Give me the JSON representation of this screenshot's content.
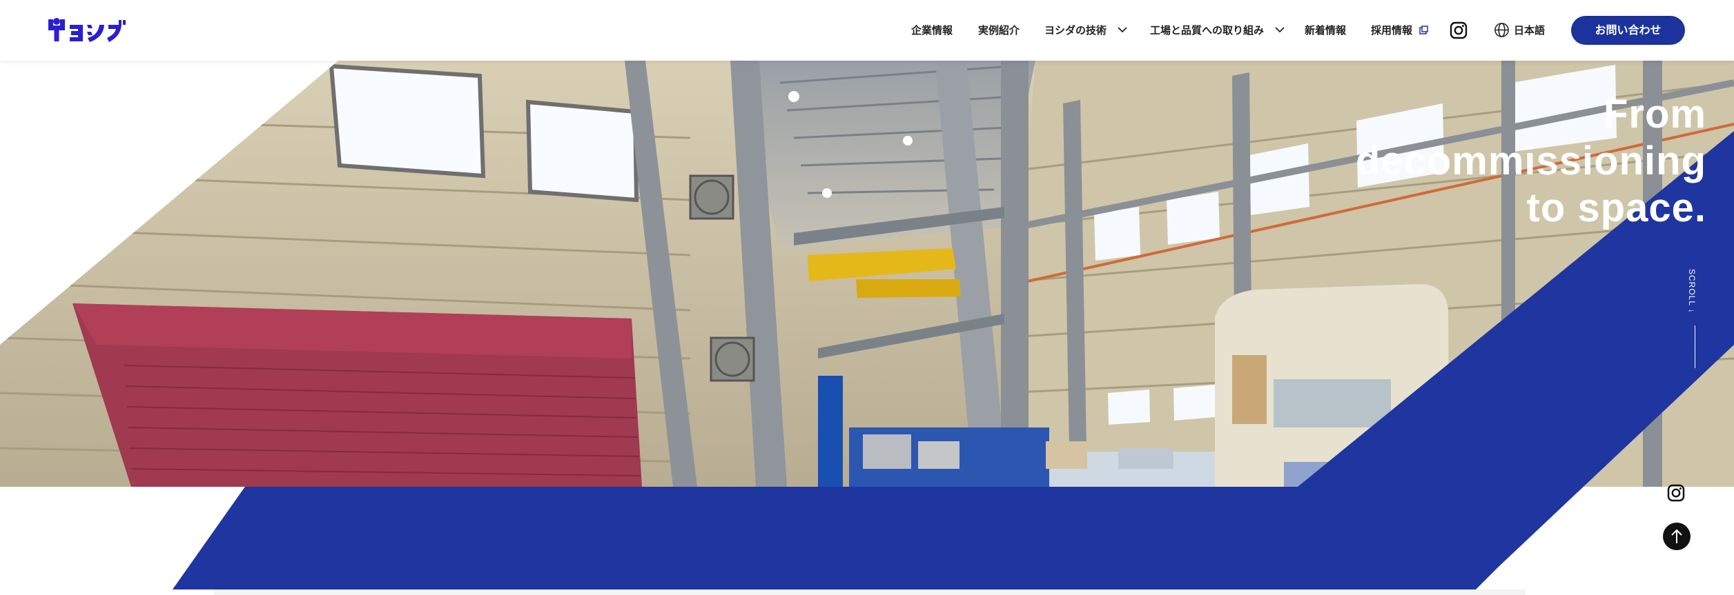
{
  "brand": {
    "logo_text": "ヨシダ",
    "colors": {
      "primary": "#1c329c",
      "logo": "#2a1fd1"
    }
  },
  "nav": {
    "items": [
      {
        "label": "企業情報",
        "icon": null
      },
      {
        "label": "実例紹介",
        "icon": null
      },
      {
        "label": "ヨシダの技術",
        "icon": "chevron-down-icon"
      },
      {
        "label": "工場と品質への取り組み",
        "icon": "chevron-down-icon"
      },
      {
        "label": "新着情報",
        "icon": null
      },
      {
        "label": "採用情報",
        "icon": "external-link-icon"
      }
    ],
    "instagram_icon": "instagram-icon",
    "language_label": "日本語",
    "language_icon": "globe-icon",
    "contact_label": "お問い合わせ"
  },
  "hero": {
    "tagline": [
      "From",
      "decommissioning",
      "to space."
    ],
    "scroll_label": "SCROLL ↓",
    "background": "factory-interior-video"
  },
  "floating": {
    "instagram_icon": "instagram-icon",
    "back_to_top_icon": "arrow-up-icon"
  }
}
